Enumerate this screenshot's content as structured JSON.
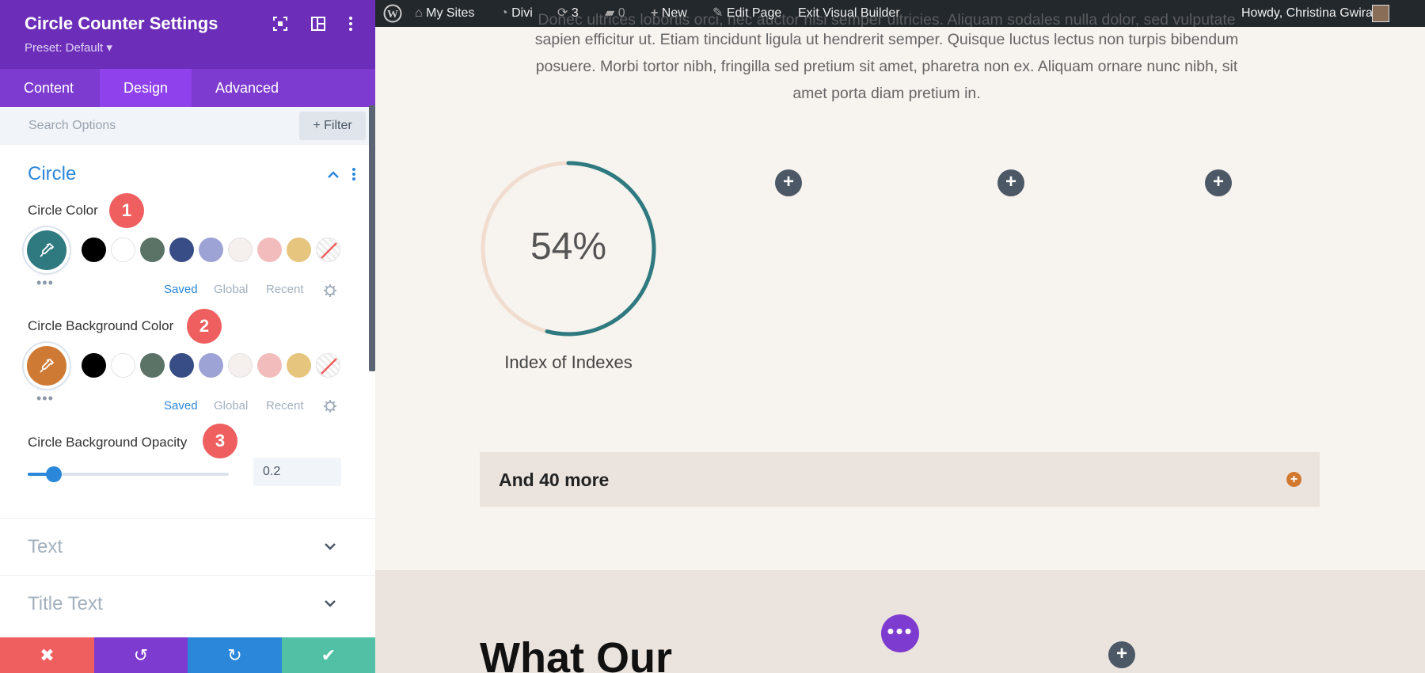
{
  "panel": {
    "title": "Circle Counter Settings",
    "preset": "Preset: Default ▾",
    "tabs": [
      "Content",
      "Design",
      "Advanced"
    ],
    "active_tab": "Design",
    "search_placeholder": "Search Options",
    "filter_label": "Filter",
    "circle_section": {
      "title": "Circle",
      "circle_color": {
        "label": "Circle Color",
        "badge": "1",
        "selected_color": "#2e7a80"
      },
      "circle_bg_color": {
        "label": "Circle Background Color",
        "badge": "2",
        "selected_color": "#cf7a34"
      },
      "swatches": [
        "#000000",
        "#ffffff",
        "#5a7366",
        "#384d85",
        "#9ea3d6",
        "#f5efee",
        "#f2bcbc",
        "#e6c57e",
        "transparent"
      ],
      "swatch_tabs": [
        "Saved",
        "Global",
        "Recent"
      ],
      "opacity": {
        "label": "Circle Background Opacity",
        "badge": "3",
        "value": "0.2",
        "fraction": 0.2
      }
    },
    "closed_sections": [
      "Text",
      "Title Text"
    ],
    "footer": {
      "cancel_icon": "close-icon",
      "undo_icon": "undo-icon",
      "redo_icon": "redo-icon",
      "save_icon": "check-icon"
    }
  },
  "admin_bar": {
    "my_sites": "My Sites",
    "divi": "Divi",
    "updates_count": "3",
    "comments_count": "0",
    "new": "New",
    "edit_page": "Edit Page",
    "exit_vb": "Exit Visual Builder",
    "howdy": "Howdy, Christina Gwira"
  },
  "content": {
    "cut_line": "Donec ultrices lobortis orci, nec auctor nisi semper ultricies. Aliquam sodales nulla dolor, sed vulputate",
    "paragraph_lines": [
      "sapien efficitur ut. Etiam tincidunt ligula ut hendrerit semper. Quisque luctus lectus non turpis bibendum",
      "posuere. Morbi tortor nibh, fringilla sed pretium sit amet, pharetra non ex. Aliquam ornare nunc nibh, sit",
      "amet porta diam pretium in."
    ],
    "counter": {
      "number": "54%",
      "percent": 54,
      "title": "Index of Indexes",
      "bar_color": "#2e7a80",
      "track_color": "#f0ddd0"
    },
    "toggle_title": "And 40 more",
    "lower_heading": "What Our",
    "fab_label": "•••"
  }
}
